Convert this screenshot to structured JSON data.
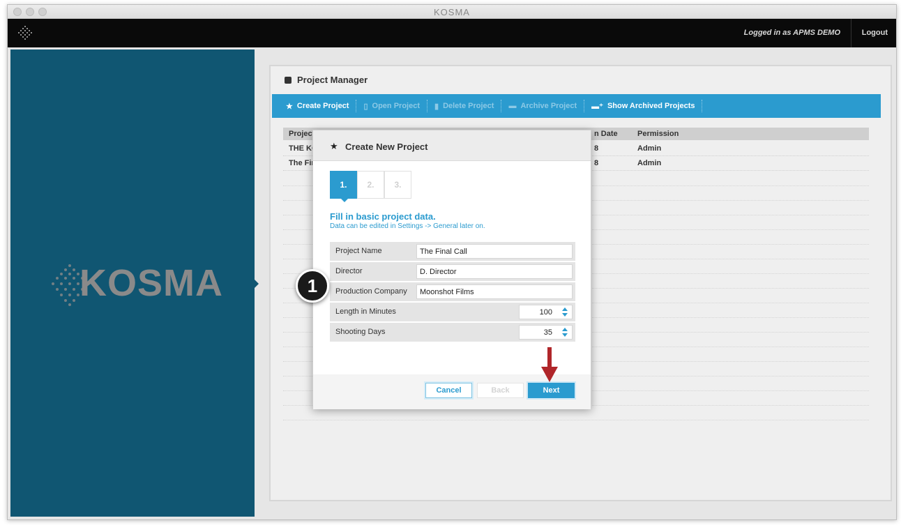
{
  "window": {
    "title": "KOSMA"
  },
  "topbar": {
    "logged_in": "Logged in as APMS DEMO",
    "logout": "Logout"
  },
  "sidebar": {
    "brand": "KOSMA"
  },
  "panel": {
    "title": "Project Manager",
    "toolbar": [
      {
        "label": "Create Project",
        "icon": "star-icon",
        "enabled": true
      },
      {
        "label": "Open Project",
        "icon": "book-icon",
        "enabled": false
      },
      {
        "label": "Delete Project",
        "icon": "trash-icon",
        "enabled": false
      },
      {
        "label": "Archive Project",
        "icon": "archive-icon",
        "enabled": false
      },
      {
        "label": "Show Archived Projects",
        "icon": "archive-plus-icon",
        "enabled": true
      }
    ],
    "table": {
      "headers": [
        "Project",
        "n Date",
        "Permission"
      ],
      "rows": [
        [
          "THE KO",
          "8",
          "Admin"
        ],
        [
          "The Fin",
          "8",
          "Admin"
        ]
      ]
    }
  },
  "modal": {
    "title": "Create New Project",
    "steps": [
      "1.",
      "2.",
      "3."
    ],
    "active_step": 1,
    "heading": "Fill in basic project data.",
    "subheading": "Data can be edited in Settings -> General later on.",
    "fields": [
      {
        "label": "Project Name",
        "value": "The Final Call",
        "type": "text"
      },
      {
        "label": "Director",
        "value": "D. Director",
        "type": "text"
      },
      {
        "label": "Production Company",
        "value": "Moonshot Films",
        "type": "text"
      },
      {
        "label": "Length in Minutes",
        "value": "100",
        "type": "number"
      },
      {
        "label": "Shooting Days",
        "value": "35",
        "type": "number"
      }
    ],
    "buttons": {
      "cancel": "Cancel",
      "back": "Back",
      "next": "Next"
    }
  },
  "annotation": {
    "callout": "1"
  },
  "colors": {
    "accent": "#2b9bcf",
    "sidebar": "#105672",
    "arrow": "#b0262a"
  }
}
